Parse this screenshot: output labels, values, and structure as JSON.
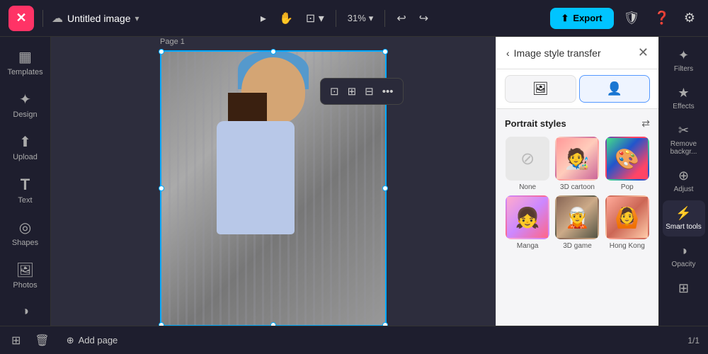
{
  "app": {
    "logo": "✕",
    "title": "Untitled image",
    "title_chevron": "▾"
  },
  "toolbar": {
    "select_tool": "▸",
    "hand_tool": "✋",
    "frame_tool": "⊡",
    "zoom_level": "31%",
    "zoom_chevron": "▾",
    "undo": "↩",
    "redo": "↪",
    "export_label": "Export",
    "shield_icon": "🛡",
    "help_icon": "?",
    "settings_icon": "⚙"
  },
  "sidebar": {
    "items": [
      {
        "id": "templates",
        "label": "Templates",
        "icon": "▦"
      },
      {
        "id": "design",
        "label": "Design",
        "icon": "✦"
      },
      {
        "id": "upload",
        "label": "Upload",
        "icon": "⬆"
      },
      {
        "id": "text",
        "label": "Text",
        "icon": "T"
      },
      {
        "id": "shapes",
        "label": "Shapes",
        "icon": "◎"
      },
      {
        "id": "photos",
        "label": "Photos",
        "icon": "⊞"
      }
    ]
  },
  "float_toolbar": {
    "crop": "⊡",
    "smart_crop": "⊞",
    "replace": "⊟",
    "more": "•••"
  },
  "panel": {
    "title": "Image style transfer",
    "back_icon": "‹",
    "close_icon": "✕",
    "tab_image": "🖼",
    "tab_portrait": "👤",
    "section_title": "Portrait styles",
    "styles": [
      {
        "id": "none",
        "label": "None",
        "type": "none"
      },
      {
        "id": "3d_cartoon",
        "label": "3D cartoon",
        "type": "3dcartoon"
      },
      {
        "id": "pop",
        "label": "Pop",
        "type": "pop"
      },
      {
        "id": "manga",
        "label": "Manga",
        "type": "manga"
      },
      {
        "id": "3d_game",
        "label": "3D game",
        "type": "3dgame"
      },
      {
        "id": "hong_kong",
        "label": "Hong Kong",
        "type": "hongkong"
      }
    ]
  },
  "right_sidebar": {
    "items": [
      {
        "id": "filters",
        "label": "Filters",
        "icon": "✦"
      },
      {
        "id": "effects",
        "label": "Effects",
        "icon": "★"
      },
      {
        "id": "remove_bg",
        "label": "Remove backgr...",
        "icon": "✂"
      },
      {
        "id": "adjust",
        "label": "Adjust",
        "icon": "⊕"
      },
      {
        "id": "smart_tools",
        "label": "Smart tools",
        "icon": "⚡",
        "active": true
      },
      {
        "id": "opacity",
        "label": "Opacity",
        "icon": "◑"
      },
      {
        "id": "more_options",
        "label": "",
        "icon": "⊞"
      }
    ]
  },
  "bottom_bar": {
    "add_page": "Add page",
    "page_indicator": "1/1"
  },
  "canvas": {
    "label": "Page 1"
  }
}
